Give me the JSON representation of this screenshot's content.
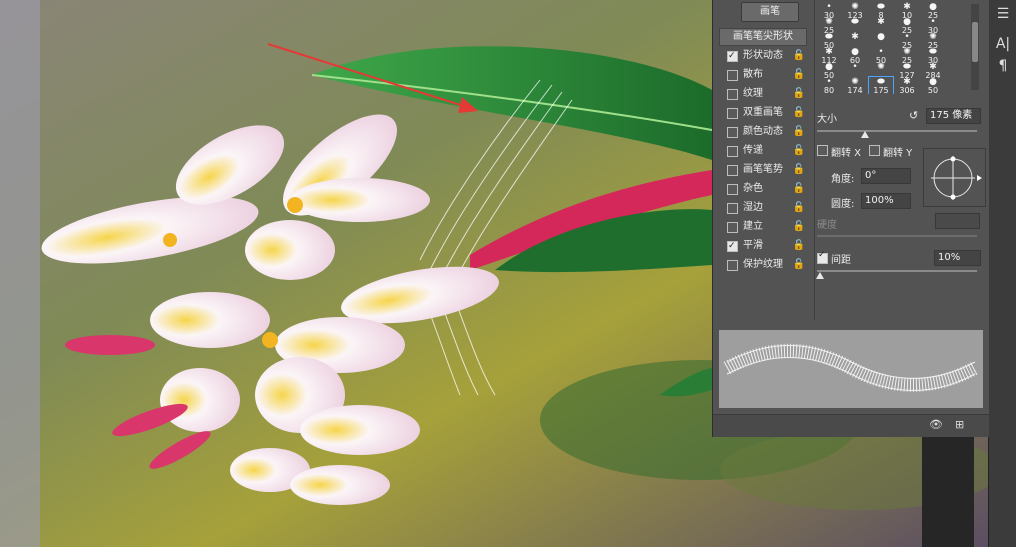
{
  "panel": {
    "brush_button": "画笔",
    "tip_shape_button": "画笔笔尖形状",
    "options": [
      {
        "label": "形状动态",
        "checked": true
      },
      {
        "label": "散布",
        "checked": false
      },
      {
        "label": "纹理",
        "checked": false
      },
      {
        "label": "双重画笔",
        "checked": false
      },
      {
        "label": "颜色动态",
        "checked": false
      },
      {
        "label": "传递",
        "checked": false
      },
      {
        "label": "画笔笔势",
        "checked": false
      },
      {
        "label": "杂色",
        "checked": false
      },
      {
        "label": "湿边",
        "checked": false
      },
      {
        "label": "建立",
        "checked": false
      },
      {
        "label": "平滑",
        "checked": true
      },
      {
        "label": "保护纹理",
        "checked": false
      }
    ],
    "presets": [
      [
        "30",
        "123",
        "8",
        "10",
        "25"
      ],
      [
        "25",
        "",
        "",
        "25",
        "30"
      ],
      [
        "50",
        "",
        "",
        "25",
        "25"
      ],
      [
        "112",
        "60",
        "50",
        "25",
        "30"
      ],
      [
        "50",
        "",
        "",
        "127",
        "284"
      ],
      [
        "80",
        "174",
        "175",
        "306",
        "50"
      ]
    ],
    "selected_preset": "175",
    "size_label": "大小",
    "size_value": "175 像素",
    "size_fraction": 0.3,
    "flip_x_label": "翻转 X",
    "flip_y_label": "翻转 Y",
    "angle_label": "角度:",
    "angle_value": "0°",
    "roundness_label": "圆度:",
    "roundness_value": "100%",
    "hardness_label": "硬度",
    "spacing_label": "间距",
    "spacing_checked": true,
    "spacing_value": "10%",
    "spacing_fraction": 0.02
  },
  "right_strip": {
    "icons": [
      "brush-settings-icon",
      "character-icon",
      "paragraph-icon"
    ]
  },
  "colors": {
    "panel_bg": "#535353",
    "selection": "#4aa3ff",
    "arrow": "#e53935"
  }
}
